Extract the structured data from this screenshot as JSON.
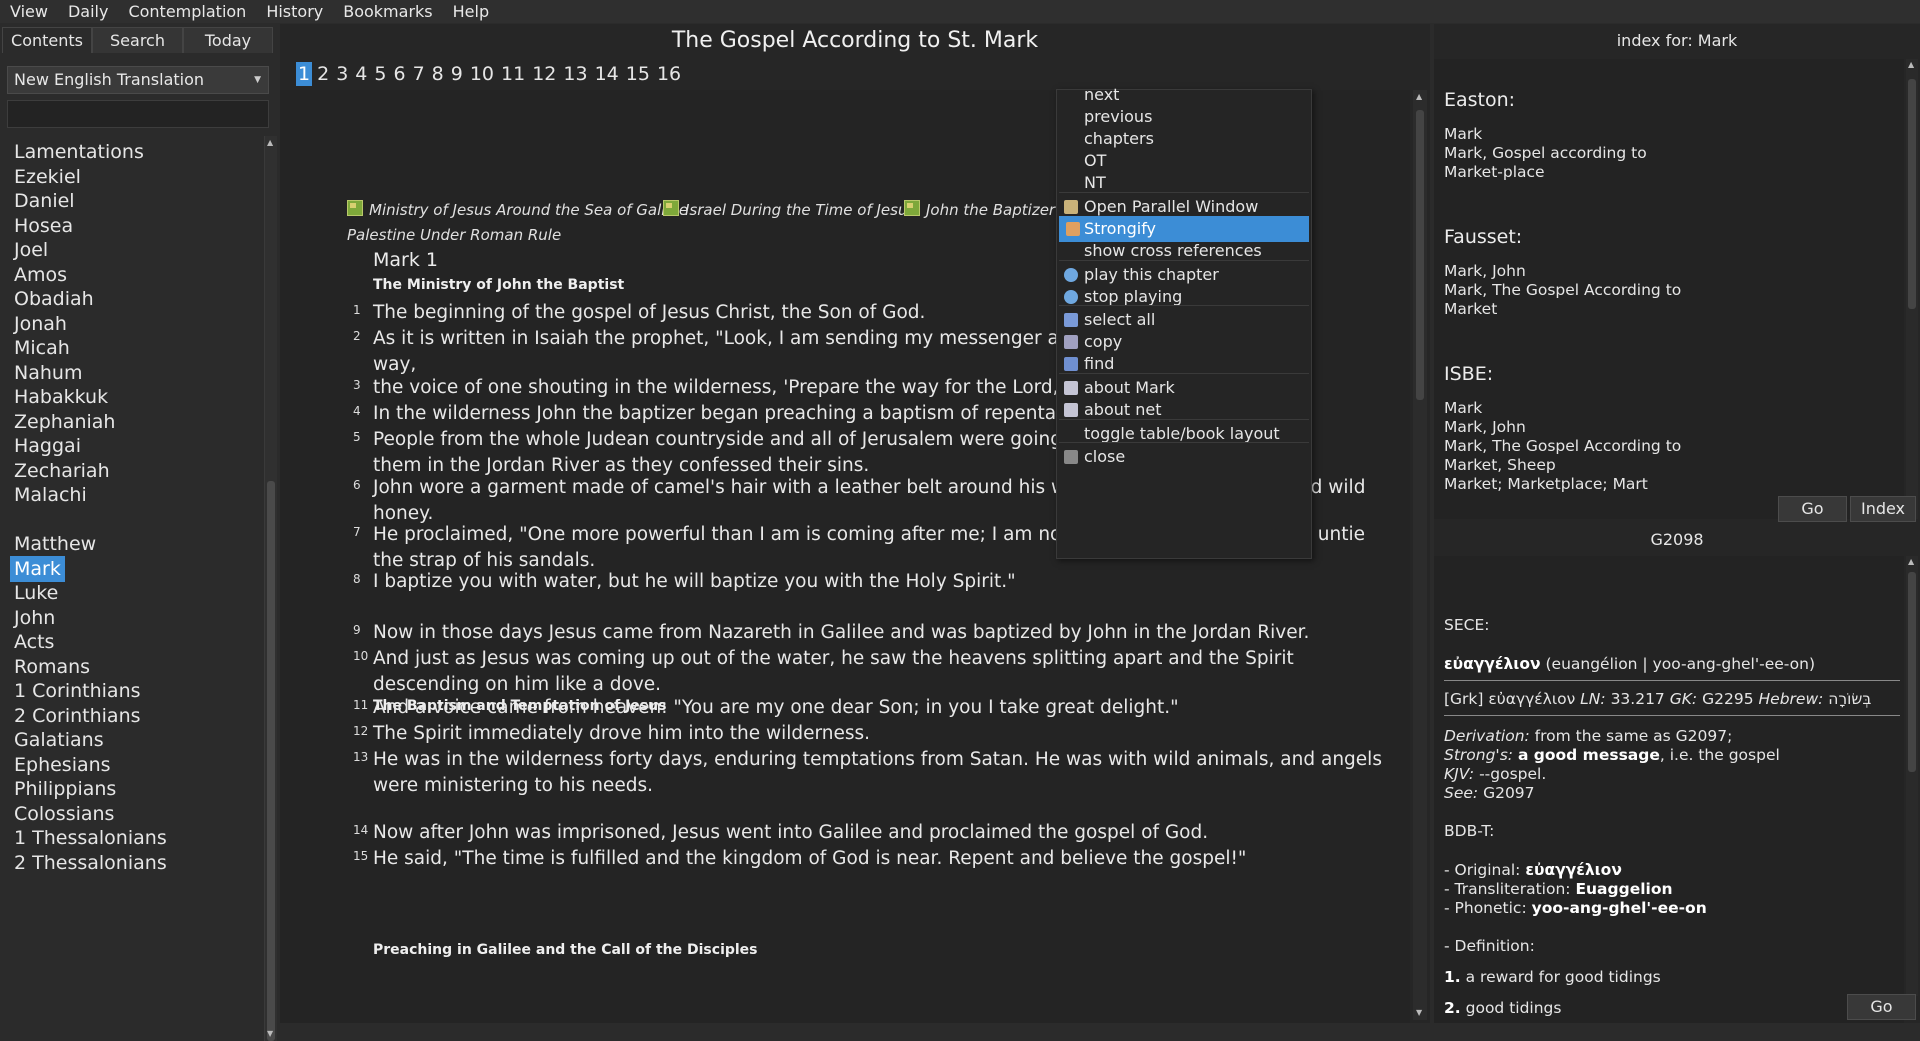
{
  "menubar": [
    "View",
    "Daily",
    "Contemplation",
    "History",
    "Bookmarks",
    "Help"
  ],
  "left_panel": {
    "tabs": [
      "Contents",
      "Search",
      "Today"
    ],
    "translation": "New English Translation",
    "books_ot": [
      "Lamentations",
      "Ezekiel",
      "Daniel",
      "Hosea",
      "Joel",
      "Amos",
      "Obadiah",
      "Jonah",
      "Micah",
      "Nahum",
      "Habakkuk",
      "Zephaniah",
      "Haggai",
      "Zechariah",
      "Malachi"
    ],
    "books_nt": [
      "Matthew",
      "Mark",
      "Luke",
      "John",
      "Acts",
      "Romans",
      "1 Corinthians",
      "2 Corinthians",
      "Galatians",
      "Ephesians",
      "Philippians",
      "Colossians",
      "1 Thessalonians",
      "2 Thessalonians"
    ],
    "selected_book": "Mark"
  },
  "center": {
    "title": "The Gospel According to St. Mark",
    "chapters": [
      "1",
      "2",
      "3",
      "4",
      "5",
      "6",
      "7",
      "8",
      "9",
      "10",
      "11",
      "12",
      "13",
      "14",
      "15",
      "16"
    ],
    "current_chapter": "1",
    "maps": [
      "Ministry of Jesus Around the Sea of Galilee",
      "Israel During the Time of Jesus",
      "John the Baptizer",
      "Palestine Under Roman Rule"
    ],
    "chapter_heading": "Mark 1",
    "sections": [
      "The Ministry of John the Baptist",
      "The Baptism and Temptation of Jesus",
      "Preaching in Galilee and the Call of the Disciples"
    ],
    "verses": [
      {
        "n": "1",
        "text": "The beginning of the gospel of Jesus Christ, the Son of God."
      },
      {
        "n": "2",
        "text": "As it is written in Isaiah the prophet, \"Look, I am sending my messenger ahea                                                         our\nway,"
      },
      {
        "n": "3",
        "text": "the voice of one shouting in the wilderness, 'Prepare the way for the Lord, ma"
      },
      {
        "n": "4",
        "text": "In the wilderness John the baptizer began preaching a baptism of repentance"
      },
      {
        "n": "5",
        "text": "People from the whole Judean countryside and all of Jerusalem were going ou                                                         ing\nthem in the Jordan River as they confessed their sins."
      },
      {
        "n": "6",
        "text": "John wore a garment made of camel's hair with a leather belt around his waist, and he ate locusts and wild\nhoney."
      },
      {
        "n": "7",
        "text": "He proclaimed, \"One more powerful than I am is coming after me; I am not worthy to bend down and untie\nthe strap of his sandals."
      },
      {
        "n": "8",
        "text": "I baptize you with water, but he will baptize you with the Holy Spirit.\""
      },
      {
        "n": "9",
        "text": "Now in those days Jesus came from Nazareth in Galilee and was baptized by John in the Jordan River."
      },
      {
        "n": "10",
        "text": "And just as Jesus was coming up out of the water, he saw the heavens splitting apart and the Spirit\ndescending on him like a dove."
      },
      {
        "n": "11",
        "text": "And a voice came from heaven: \"You are my one dear Son; in you I take great delight.\""
      },
      {
        "n": "12",
        "text": "The Spirit immediately drove him into the wilderness."
      },
      {
        "n": "13",
        "text": "He was in the wilderness forty days, enduring temptations from Satan. He was with wild animals, and angels\nwere ministering to his needs."
      },
      {
        "n": "14",
        "text": "Now after John was imprisoned, Jesus went into Galilee and proclaimed the gospel of God."
      },
      {
        "n": "15",
        "text": "He said, \"The time is fulfilled and the kingdom of God is near. Repent and believe the gospel!\""
      }
    ]
  },
  "context_menu": {
    "items": [
      "next",
      "previous",
      "chapters",
      "OT",
      "NT",
      "Open Parallel Window",
      "Strongify",
      "show cross references",
      "play this chapter",
      "stop playing",
      "select all",
      "copy",
      "find",
      "about Mark",
      "about net",
      "toggle table/book layout",
      "close"
    ],
    "highlighted": "Strongify"
  },
  "index_panel": {
    "title": "index for: Mark",
    "sections": [
      {
        "name": "Easton:",
        "entries": [
          "Mark",
          "Mark, Gospel according to",
          "Market-place"
        ]
      },
      {
        "name": "Fausset:",
        "entries": [
          "Mark, John",
          "Mark, The Gospel According to",
          "Market"
        ]
      },
      {
        "name": "ISBE:",
        "entries": [
          "Mark",
          "Mark, John",
          "Mark, The Gospel According to",
          "Market, Sheep",
          "Market; Marketplace; Mart"
        ]
      }
    ],
    "go_label": "Go",
    "index_label": "Index"
  },
  "strongs_panel": {
    "title": "G2098",
    "sece_label": "SECE:",
    "greek_word": "εὐαγγέλιον",
    "greek_translit": "(euangélion | yoo-ang-ghel'-ee-on)",
    "grk_prefix": "[Grk] εὐαγγέλιον",
    "ln_label": "LN:",
    "ln_value": "33.217",
    "gk_label": "GK:",
    "gk_value": "G2295",
    "hebrew_label": "Hebrew:",
    "hebrew_value": "בְּשׂוֹרָה",
    "derivation_label": "Derivation:",
    "derivation_value": "from the same as G2097;",
    "strongs_label": "Strong's:",
    "strongs_bold": "a good message",
    "strongs_rest": ", i.e. the gospel",
    "kjv_label": "KJV:",
    "kjv_value": "--gospel.",
    "see_label": "See:",
    "see_value": "G2097",
    "bdbt_label": "BDB-T:",
    "original_label": "- Original:",
    "original_value": "εὐαγγέλιον",
    "translit_label": "- Transliteration:",
    "translit_value": "Euaggelion",
    "phonetic_label": "- Phonetic:",
    "phonetic_value": "yoo-ang-ghel'-ee-on",
    "definition_label": "- Definition:",
    "defs": [
      {
        "n": "1.",
        "text": "a reward for good tidings"
      },
      {
        "n": "2.",
        "text": "good tidings"
      }
    ],
    "go_label": "Go"
  }
}
